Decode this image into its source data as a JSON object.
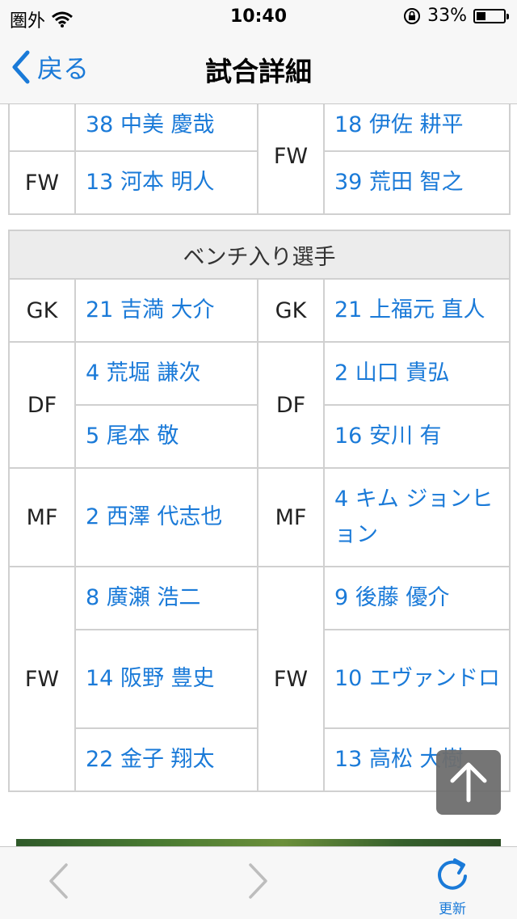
{
  "status_bar": {
    "carrier": "圏外",
    "time": "10:40",
    "battery_percent": "33%",
    "battery_level": 0.33
  },
  "nav": {
    "back_label": "戻る",
    "title": "試合詳細"
  },
  "top_section": {
    "left_rows": [
      {
        "position": "",
        "player": "38 中美 慶哉"
      },
      {
        "position": "FW",
        "player": "13 河本 明人"
      }
    ],
    "right_position": "FW",
    "right_players": [
      "18 伊佐 耕平",
      "39 荒田 智之"
    ]
  },
  "bench": {
    "header": "ベンチ入り選手",
    "groups": [
      {
        "left_position": "GK",
        "left_players": [
          "21 吉満 大介"
        ],
        "right_position": "GK",
        "right_players": [
          "21 上福元 直人"
        ]
      },
      {
        "left_position": "DF",
        "left_players": [
          "4 荒堀 謙次",
          "5 尾本 敬"
        ],
        "right_position": "DF",
        "right_players": [
          "2 山口 貴弘",
          "16 安川 有"
        ]
      },
      {
        "left_position": "MF",
        "left_players": [
          "2 西澤 代志也"
        ],
        "right_position": "MF",
        "right_players": [
          "4 キム ジョンヒョン"
        ]
      },
      {
        "left_position": "FW",
        "left_players": [
          "8 廣瀬 浩二",
          "14 阪野 豊史",
          "22 金子 翔太"
        ],
        "right_position": "FW",
        "right_players": [
          "9 後藤 優介",
          "10 エヴァンドロ",
          "13 高松 大樹"
        ]
      }
    ]
  },
  "toolbar": {
    "refresh_label": "更新"
  },
  "colors": {
    "link": "#1a7ad8",
    "border": "#d0d0d0",
    "header_bg": "#ececec"
  }
}
